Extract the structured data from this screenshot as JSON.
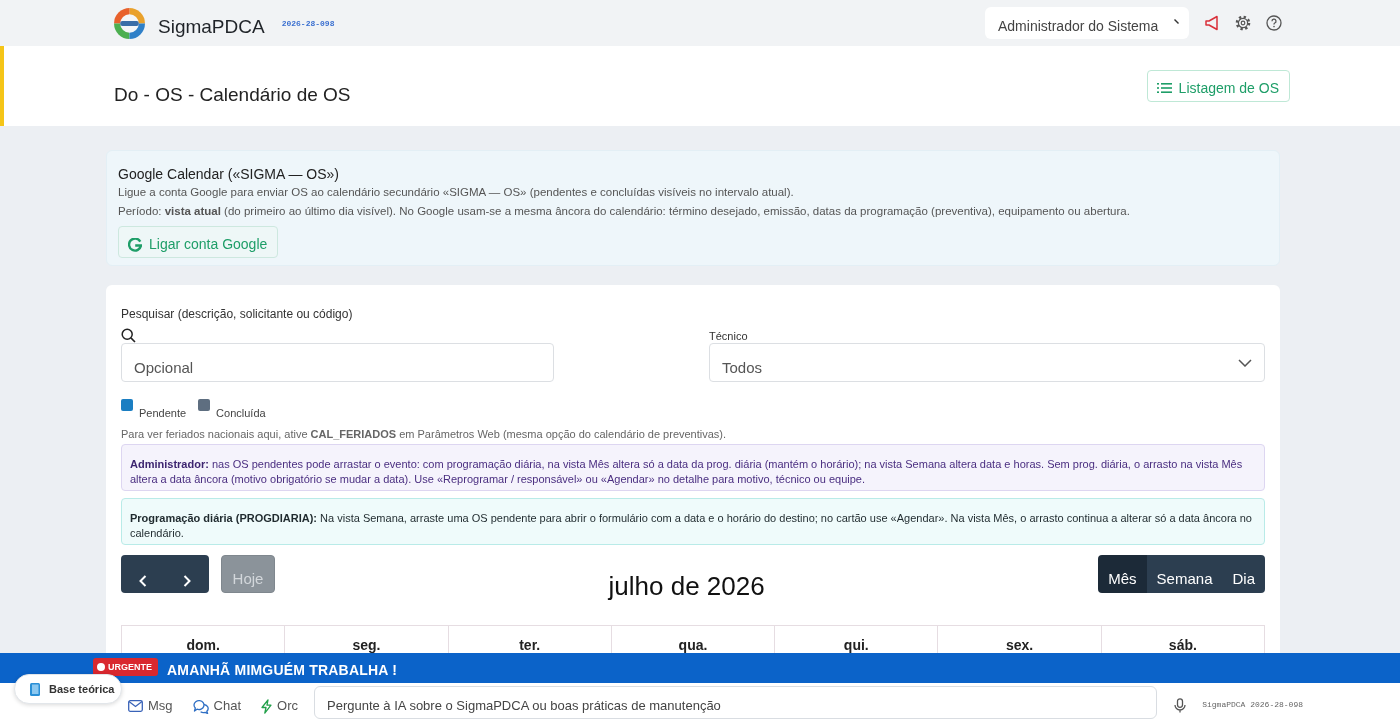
{
  "header": {
    "app_name": "SigmaPDCA",
    "version": "2026-28-098",
    "user": "Administrador do Sistema"
  },
  "page": {
    "title": "Do - OS - Calendário de OS",
    "action_button": "Listagem de OS"
  },
  "google_calendar": {
    "title": "Google Calendar («SIGMA — OS»)",
    "description": "Ligue a conta Google para enviar OS ao calendário secundário «SIGMA — OS» (pendentes e concluídas visíveis no intervalo atual).",
    "period": "Período: **vista atual** (do primeiro ao último dia visível). No Google usam-se a mesma âncora do calendário: término desejado, emissão, datas da programação (preventiva), equipamento ou abertura.",
    "button": "Ligar conta Google"
  },
  "filters": {
    "search": {
      "label": "Pesquisar (descrição, solicitante ou código)",
      "placeholder": "Opcional"
    },
    "technician": {
      "label": "Técnico",
      "value": "Todos"
    }
  },
  "legend": [
    {
      "label": "Pendente",
      "color": "#1a7ec2"
    },
    {
      "label": "Concluída",
      "color": "#5e6e80"
    }
  ],
  "holiday_note": "Para ver feriados nacionais aqui, ative **CAL_FERIADOS** em Parâmetros Web (mesma opção do calendário de preventivas).",
  "notices": [
    {
      "kind": "admin",
      "text": "**Administrador:** nas OS pendentes pode arrastar o evento: com programação diária, na vista Mês altera só a data da prog. diária (mantém o horário); na vista Semana altera data e horas. Sem prog. diária, o arrasto na vista Mês altera a data âncora (motivo obrigatório se mudar a data). Use «Reprogramar / responsável» ou «Agendar» no detalhe para motivo, técnico ou equipe."
    },
    {
      "kind": "info",
      "text": "**Programação diária (PROGDIARIA):** Na vista Semana, arraste uma OS pendente para abrir o formulário com a data e o horário do destino; no cartão use «Agendar». Na vista Mês, o arrasto continua a alterar só a data âncora no calendário."
    }
  ],
  "calendar": {
    "today_button": {
      "label": "Hoje",
      "disabled": true
    },
    "title": "julho de 2026",
    "views": [
      {
        "label": "Mês",
        "selected": true
      },
      {
        "label": "Semana",
        "selected": false
      },
      {
        "label": "Dia",
        "selected": false
      }
    ],
    "weekdays": [
      "dom.",
      "seg.",
      "ter.",
      "qua.",
      "qui.",
      "sex.",
      "sáb."
    ]
  },
  "banner": {
    "badge": "URGENTE",
    "message": "AMANHÃ MIMGUÉM TRABALHA !"
  },
  "bottom_bar": {
    "help_button": "Base teórica",
    "shortcuts": [
      {
        "kind": "msg",
        "label": "Msg"
      },
      {
        "kind": "chat",
        "label": "Chat"
      },
      {
        "kind": "orc",
        "label": "Orc"
      }
    ],
    "ask": {
      "placeholder": "Pergunte à IA sobre o SigmaPDCA ou boas práticas de manutenção"
    },
    "version": "SigmaPDCA 2026-28-098"
  }
}
